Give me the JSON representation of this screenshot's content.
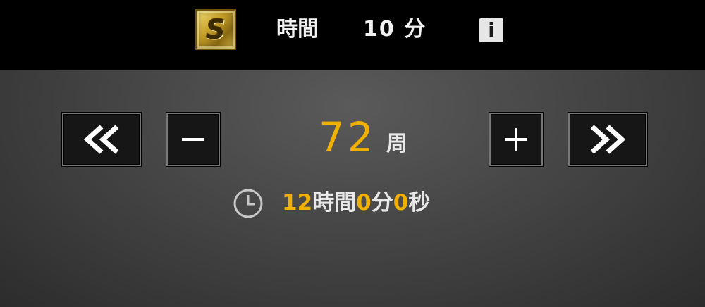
{
  "header": {
    "badge_letter": "S",
    "time_label": "時間",
    "time_value": "10 分",
    "info_label": "i"
  },
  "counter": {
    "value": "72",
    "unit": "周"
  },
  "duration": {
    "hours": "12",
    "hours_unit": "時間",
    "minutes": "0",
    "minutes_unit": "分",
    "seconds": "0",
    "seconds_unit": "秒"
  },
  "icons": {
    "badge": "rank-s-icon",
    "info": "info-icon",
    "fast_decrement": "double-chevron-left-icon",
    "decrement": "minus-icon",
    "increment": "plus-icon",
    "fast_increment": "double-chevron-right-icon",
    "clock": "clock-icon"
  },
  "colors": {
    "accent": "#f0b100",
    "text": "#e8e8e8",
    "header_bg": "#000000",
    "button_bg": "#161616"
  }
}
